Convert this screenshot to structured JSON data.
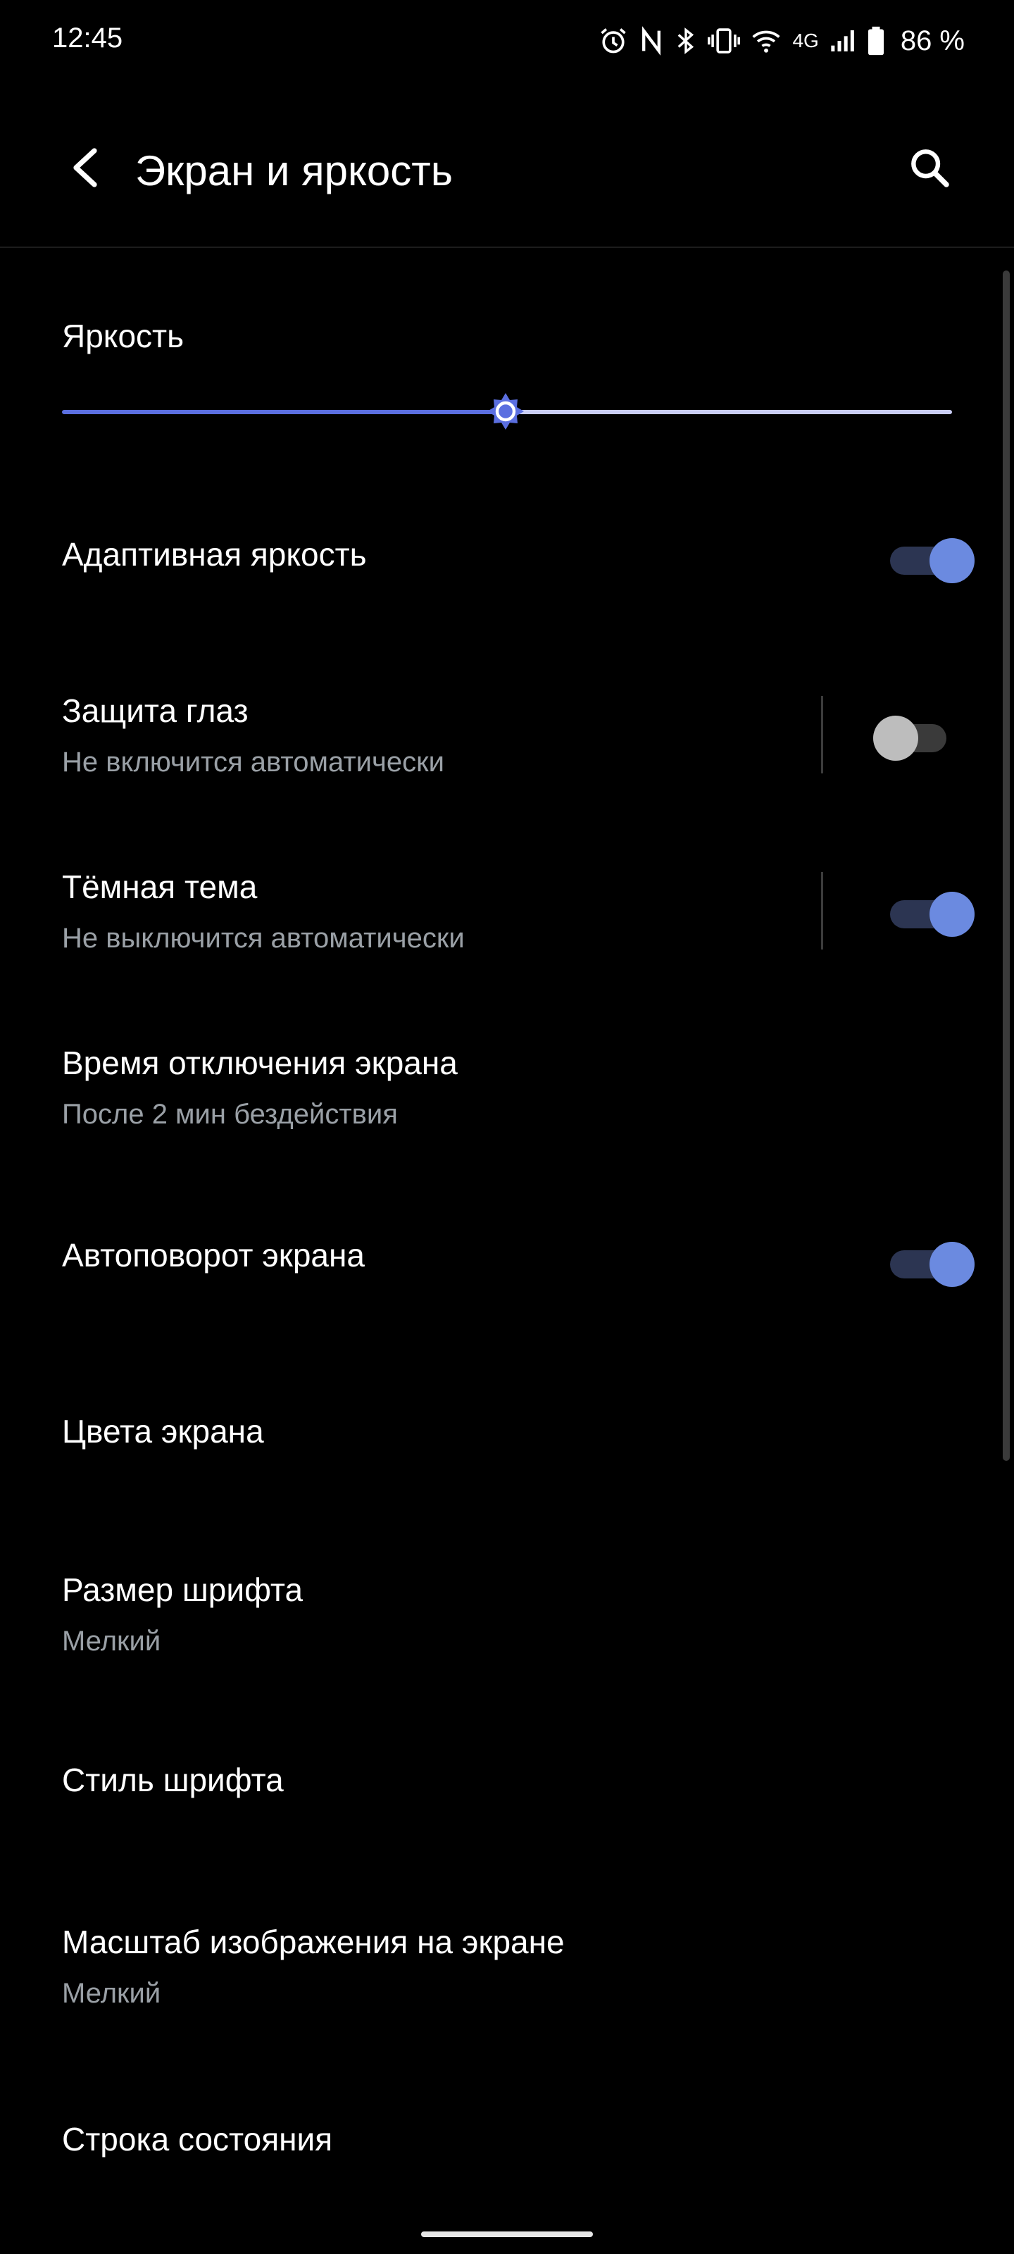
{
  "status_bar": {
    "time": "12:45",
    "network": "4G",
    "battery_percent": "86 %",
    "icons": [
      "alarm-icon",
      "nfc-icon",
      "bluetooth-icon",
      "vibrate-icon",
      "wifi-icon",
      "signal-icon",
      "battery-icon"
    ]
  },
  "header": {
    "title": "Экран и яркость",
    "back_icon": "back-arrow-icon",
    "search_icon": "search-icon"
  },
  "brightness": {
    "label": "Яркость",
    "level": 0.5,
    "accent": "#5b6fe0"
  },
  "settings": {
    "adaptive_brightness": {
      "title": "Адаптивная яркость",
      "enabled": true
    },
    "eye_protection": {
      "title": "Защита глаз",
      "subtitle": "Не включится автоматически",
      "enabled": false
    },
    "dark_theme": {
      "title": "Тёмная тема",
      "subtitle": "Не выключится автоматически",
      "enabled": true
    },
    "screen_timeout": {
      "title": "Время отключения экрана",
      "subtitle": "После 2 мин бездействия"
    },
    "auto_rotate": {
      "title": "Автоповорот экрана",
      "enabled": true
    },
    "screen_colors": {
      "title": "Цвета экрана"
    },
    "font_size": {
      "title": "Размер шрифта",
      "subtitle": "Мелкий"
    },
    "font_style": {
      "title": "Стиль шрифта"
    },
    "display_scale": {
      "title": "Масштаб изображения на экране",
      "subtitle": "Мелкий"
    },
    "status_bar": {
      "title": "Строка состояния"
    }
  },
  "colors": {
    "toggle_on_knob": "#6b8ae0",
    "toggle_on_track": "#2c3552",
    "toggle_off_knob": "#bdbdbd",
    "subtitle": "#9aa0a6"
  }
}
